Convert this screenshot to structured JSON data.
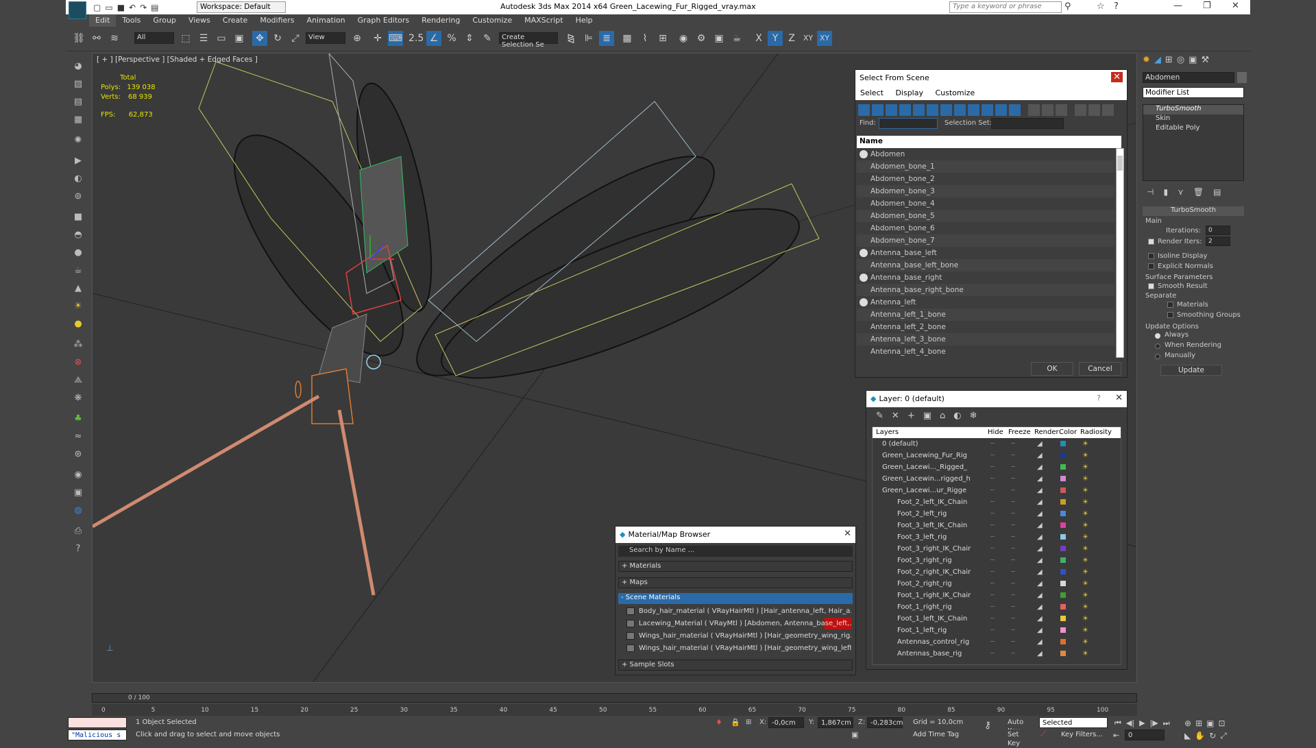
{
  "app": {
    "title": "Autodesk 3ds Max  2014 x64     Green_Lacewing_Fur_Rigged_vray.max",
    "workspace": "Workspace: Default",
    "search_placeholder": "Type a keyword or phrase"
  },
  "menu": [
    "Edit",
    "Tools",
    "Group",
    "Views",
    "Create",
    "Modifiers",
    "Animation",
    "Graph Editors",
    "Rendering",
    "Customize",
    "MAXScript",
    "Help"
  ],
  "toolbar": {
    "filter": "All",
    "ref_coord": "View",
    "selection_set": "Create Selection Se",
    "snap_angle": "2.5",
    "axes": [
      "X",
      "Y",
      "Z",
      "XY",
      "XY"
    ]
  },
  "viewport": {
    "label": "[ + ] [Perspective ] [Shaded + Edged Faces ]",
    "stats_total": "Total",
    "polys_label": "Polys:",
    "polys": "139 038",
    "verts_label": "Verts:",
    "verts": "68 939",
    "fps_label": "FPS:",
    "fps": "62,873"
  },
  "select_from_scene": {
    "title": "Select From Scene",
    "menu": [
      "Select",
      "Display",
      "Customize"
    ],
    "find_label": "Find:",
    "selection_set_label": "Selection Set:",
    "column": "Name",
    "items": [
      "Abdomen",
      "Abdomen_bone_1",
      "Abdomen_bone_2",
      "Abdomen_bone_3",
      "Abdomen_bone_4",
      "Abdomen_bone_5",
      "Abdomen_bone_6",
      "Abdomen_bone_7",
      "Antenna_base_left",
      "Antenna_base_left_bone",
      "Antenna_base_right",
      "Antenna_base_right_bone",
      "Antenna_left",
      "Antenna_left_1_bone",
      "Antenna_left_2_bone",
      "Antenna_left_3_bone",
      "Antenna_left_4_bone"
    ],
    "ok": "OK",
    "cancel": "Cancel"
  },
  "layers": {
    "title": "Layer: 0 (default)",
    "headers": [
      "Layers",
      "Hide",
      "Freeze",
      "Render",
      "Color",
      "Radiosity"
    ],
    "rows": [
      {
        "name": "0 (default)",
        "color": "#1f8fb8"
      },
      {
        "name": "Green_Lacewing_Fur_Rig",
        "color": "#1a3a9a"
      },
      {
        "name": "Green_Lacewi..._Rigged_",
        "color": "#3ac04a"
      },
      {
        "name": "Green_Lacewin...rigged_h",
        "color": "#d08ad0"
      },
      {
        "name": "Green_Lacewi...ur_Rigge",
        "color": "#d05858"
      },
      {
        "name": "Foot_2_left_IK_Chain",
        "color": "#c8a020"
      },
      {
        "name": "Foot_2_left_rig",
        "color": "#4a88e0"
      },
      {
        "name": "Foot_3_left_IK_Chain",
        "color": "#e040a0"
      },
      {
        "name": "Foot_3_left_rig",
        "color": "#88c8e8"
      },
      {
        "name": "Foot_3_right_IK_Chair",
        "color": "#7040c0"
      },
      {
        "name": "Foot_3_right_rig",
        "color": "#40b070"
      },
      {
        "name": "Foot_2_right_IK_Chair",
        "color": "#3050c8"
      },
      {
        "name": "Foot_2_right_rig",
        "color": "#d8d8d8"
      },
      {
        "name": "Foot_1_right_IK_Chair",
        "color": "#40a030"
      },
      {
        "name": "Foot_1_right_rig",
        "color": "#e86060"
      },
      {
        "name": "Foot_1_left_IK_Chain",
        "color": "#e8c840"
      },
      {
        "name": "Foot_1_left_rig",
        "color": "#f090d0"
      },
      {
        "name": "Antennas_control_rig",
        "color": "#e07030"
      },
      {
        "name": "Antennas_base_rig",
        "color": "#e08840"
      }
    ]
  },
  "material_browser": {
    "title": "Material/Map Browser",
    "search": "Search by Name ...",
    "sections": [
      "+ Materials",
      "+ Maps",
      "- Scene Materials"
    ],
    "materials": [
      "Body_hair_material ( VRayHairMtl ) [Hair_antenna_left, Hair_a...",
      "Lacewing_Material ( VRayMtl ) [Abdomen, Antenna_base_left,...",
      "Wings_hair_material ( VRayHairMtl ) [Hair_geometry_wing_rig...",
      "Wings_hair_material ( VRayHairMtl ) [Hair_geometry_wing_left..."
    ],
    "sample_slots": "+ Sample Slots"
  },
  "command_panel": {
    "object_name": "Abdomen",
    "modifier_list": "Modifier List",
    "stack": [
      "TurboSmooth",
      "Skin",
      "Editable Poly"
    ],
    "rollout": "TurboSmooth",
    "main": "Main",
    "iterations_label": "Iterations:",
    "iterations": "0",
    "render_iters_label": "Render Iters:",
    "render_iters": "2",
    "isoline": "Isoline Display",
    "explicit": "Explicit Normals",
    "surface": "Surface Parameters",
    "smooth_result": "Smooth Result",
    "separate": "Separate",
    "materials": "Materials",
    "smoothing_groups": "Smoothing Groups",
    "update_options": "Update Options",
    "always": "Always",
    "when_rendering": "When Rendering",
    "manually": "Manually",
    "update": "Update"
  },
  "timeline": {
    "frame": "0 / 100",
    "ticks": [
      "0",
      "5",
      "10",
      "15",
      "20",
      "25",
      "30",
      "35",
      "40",
      "45",
      "50",
      "55",
      "60",
      "65",
      "70",
      "75",
      "80",
      "85",
      "90",
      "95",
      "100"
    ]
  },
  "status": {
    "selected": "1 Object Selected",
    "prompt": "Click and drag to select and move objects",
    "maxscript": "\"Malicious s",
    "x": "-0,0cm",
    "y": "1,867cm",
    "z": "-0,283cm",
    "grid": "Grid = 10,0cm",
    "auto_key": "Auto Key",
    "set_key": "Set Key",
    "key_mode": "Selected",
    "key_filters": "Key Filters...",
    "add_time_tag": "Add Time Tag",
    "frame": "0"
  }
}
